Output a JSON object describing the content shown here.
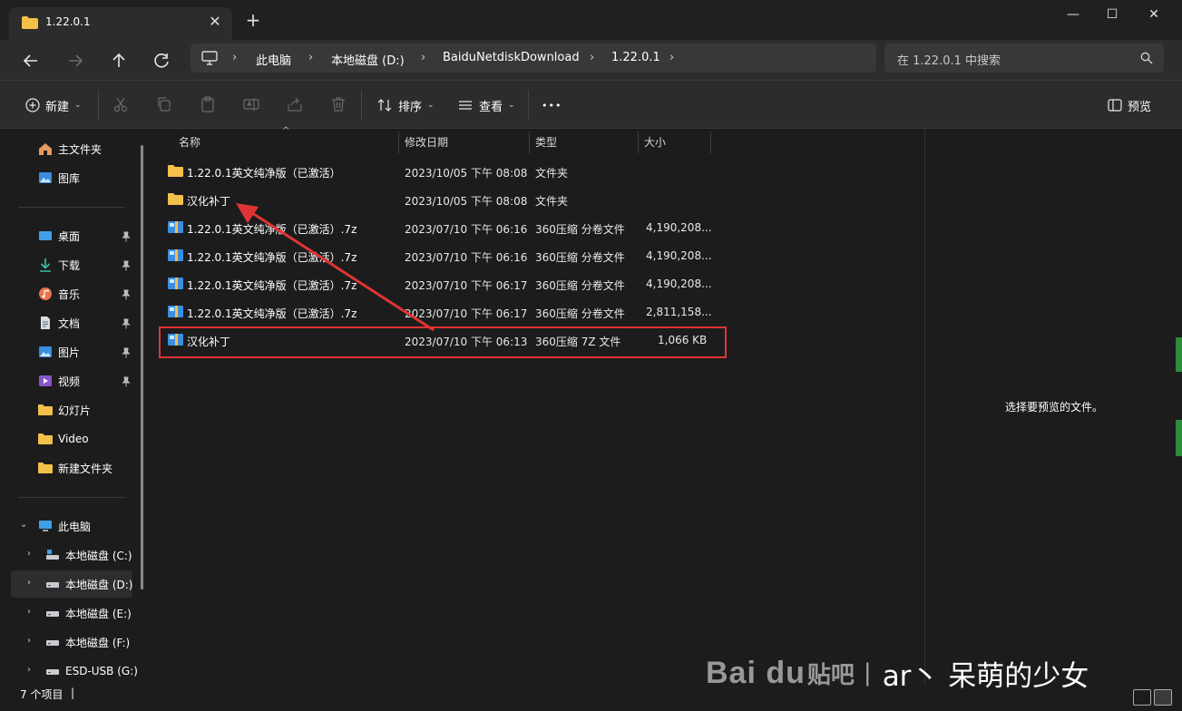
{
  "window": {
    "tab_title": "1.22.0.1",
    "tab_close": "✕",
    "new_tab": "+",
    "minimize": "—",
    "maximize": "☐",
    "close": "✕"
  },
  "breadcrumb": {
    "items": [
      "此电脑",
      "本地磁盘 (D:)",
      "BaiduNetdiskDownload",
      "1.22.0.1"
    ],
    "separator": "›"
  },
  "search": {
    "placeholder": "在 1.22.0.1 中搜索"
  },
  "toolbar": {
    "new_label": "新建",
    "sort_label": "排序",
    "view_label": "查看",
    "more_label": "•••",
    "preview_label": "预览"
  },
  "sidebar": {
    "quick": [
      {
        "label": "主文件夹",
        "icon": "home-icon"
      },
      {
        "label": "图库",
        "icon": "gallery-icon"
      }
    ],
    "pinned": [
      {
        "label": "桌面",
        "icon": "desktop-icon"
      },
      {
        "label": "下载",
        "icon": "download-icon"
      },
      {
        "label": "音乐",
        "icon": "music-icon"
      },
      {
        "label": "文档",
        "icon": "document-icon"
      },
      {
        "label": "图片",
        "icon": "pictures-icon"
      },
      {
        "label": "视频",
        "icon": "video-icon"
      },
      {
        "label": "幻灯片",
        "icon": "folder-icon"
      },
      {
        "label": "Video",
        "icon": "folder-icon"
      },
      {
        "label": "新建文件夹",
        "icon": "folder-icon"
      }
    ],
    "this_pc": "此电脑",
    "drives": [
      {
        "label": "本地磁盘 (C:)"
      },
      {
        "label": "本地磁盘 (D:)"
      },
      {
        "label": "本地磁盘 (E:)"
      },
      {
        "label": "本地磁盘 (F:)"
      },
      {
        "label": "ESD-USB (G:)"
      }
    ]
  },
  "columns": {
    "name": "名称",
    "date": "修改日期",
    "type": "类型",
    "size": "大小"
  },
  "files": [
    {
      "name": "1.22.0.1英文纯净版（已激活）",
      "date": "2023/10/05 下午 08:08",
      "type": "文件夹",
      "size": "",
      "kind": "folder"
    },
    {
      "name": "汉化补丁",
      "date": "2023/10/05 下午 08:08",
      "type": "文件夹",
      "size": "",
      "kind": "folder"
    },
    {
      "name": "1.22.0.1英文纯净版（已激活）.7z",
      "date": "2023/07/10 下午 06:16",
      "type": "360压缩 分卷文件",
      "size": "4,190,208...",
      "kind": "archive"
    },
    {
      "name": "1.22.0.1英文纯净版（已激活）.7z",
      "date": "2023/07/10 下午 06:16",
      "type": "360压缩 分卷文件",
      "size": "4,190,208...",
      "kind": "archive"
    },
    {
      "name": "1.22.0.1英文纯净版（已激活）.7z",
      "date": "2023/07/10 下午 06:17",
      "type": "360压缩 分卷文件",
      "size": "4,190,208...",
      "kind": "archive"
    },
    {
      "name": "1.22.0.1英文纯净版（已激活）.7z",
      "date": "2023/07/10 下午 06:17",
      "type": "360压缩 分卷文件",
      "size": "2,811,158...",
      "kind": "archive"
    },
    {
      "name": "汉化补丁",
      "date": "2023/07/10 下午 06:13",
      "type": "360压缩 7Z 文件",
      "size": "1,066 KB",
      "kind": "archive"
    }
  ],
  "preview": {
    "empty_message": "选择要预览的文件。"
  },
  "status": {
    "item_count": "7 个项目",
    "divider": "|"
  },
  "watermark": {
    "logo": "Bai du",
    "brand": "贴吧",
    "bar": "|",
    "user": "ar丶 呆萌的少女"
  },
  "colors": {
    "annotation_red": "#e03434",
    "folder_yellow": "#f3c04a",
    "background": "#1c1c1c"
  }
}
